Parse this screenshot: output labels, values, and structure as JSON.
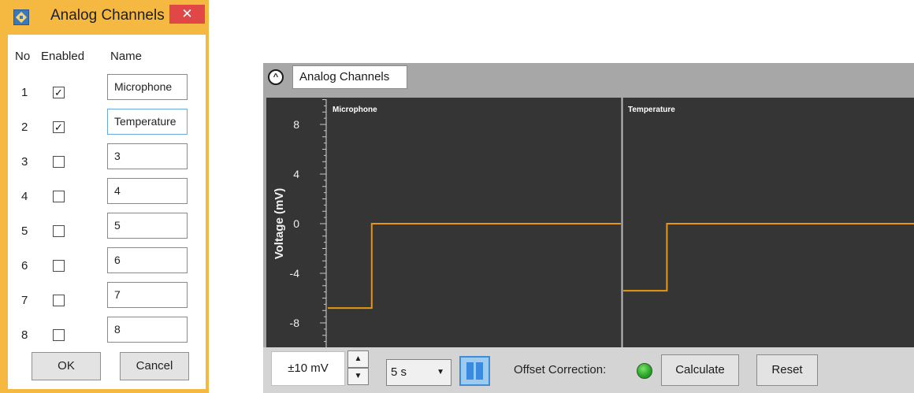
{
  "dialog": {
    "title": "Analog Channels",
    "close_glyph": "✕",
    "app_icon": "app-logo-icon",
    "headers": {
      "no": "No",
      "enabled": "Enabled",
      "name": "Name"
    },
    "rows": [
      {
        "no": "1",
        "enabled": true,
        "check": "✓",
        "name": "Microphone"
      },
      {
        "no": "2",
        "enabled": true,
        "check": "✓",
        "name": "Temperature"
      },
      {
        "no": "3",
        "enabled": false,
        "check": "",
        "name": "3"
      },
      {
        "no": "4",
        "enabled": false,
        "check": "",
        "name": "4"
      },
      {
        "no": "5",
        "enabled": false,
        "check": "",
        "name": "5"
      },
      {
        "no": "6",
        "enabled": false,
        "check": "",
        "name": "6"
      },
      {
        "no": "7",
        "enabled": false,
        "check": "",
        "name": "7"
      },
      {
        "no": "8",
        "enabled": false,
        "check": "",
        "name": "8"
      }
    ],
    "ok_label": "OK",
    "cancel_label": "Cancel",
    "accent_color": "#f5b942",
    "close_color": "#e04848"
  },
  "panel": {
    "tab_label": "Analog Channels",
    "collapse_glyph": "^",
    "range_value": "±10 mV",
    "spin_up": "▲",
    "spin_down": "▼",
    "time_value": "5 s",
    "time_arrow": "▼",
    "offset_label": "Offset Correction:",
    "offset_status_color": "#29a82a",
    "calculate_label": "Calculate",
    "reset_label": "Reset"
  },
  "chart_data": {
    "type": "line",
    "ylabel": "Voltage (mV)",
    "yticks": [
      "8",
      "4",
      "0",
      "-4",
      "-8"
    ],
    "ytick_values": [
      8,
      4,
      0,
      -4,
      -8
    ],
    "ylim": [
      -10,
      10
    ],
    "line_color": "#e8960c",
    "background": "#353535",
    "series": [
      {
        "name": "Microphone",
        "x": [
          0,
          0.15,
          0.15,
          1
        ],
        "values": [
          -6.8,
          -6.8,
          0,
          0
        ]
      },
      {
        "name": "Temperature",
        "x": [
          0,
          0.15,
          0.15,
          1
        ],
        "values": [
          -5.4,
          -5.4,
          0,
          0
        ]
      }
    ]
  }
}
